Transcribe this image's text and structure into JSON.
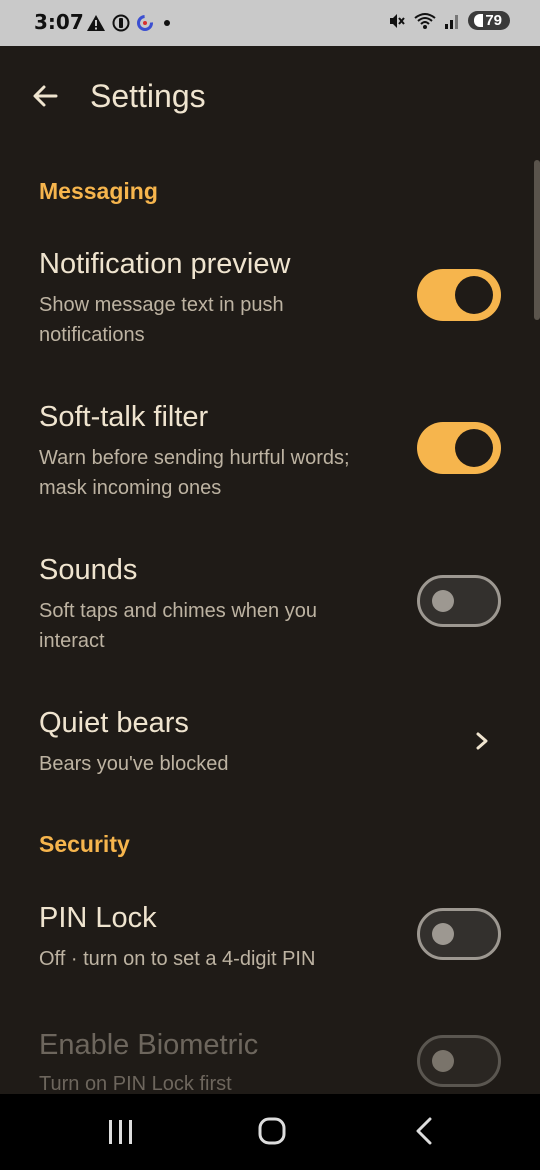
{
  "status_bar": {
    "time": "3:07",
    "battery": "79"
  },
  "header": {
    "title": "Settings"
  },
  "sections": {
    "messaging": {
      "title": "Messaging",
      "notification_preview": {
        "title": "Notification preview",
        "subtitle": "Show message text in push notifications",
        "enabled": true
      },
      "soft_talk_filter": {
        "title": "Soft-talk filter",
        "subtitle": "Warn before sending hurtful words; mask incoming ones",
        "enabled": true
      },
      "sounds": {
        "title": "Sounds",
        "subtitle": "Soft taps and chimes when you interact",
        "enabled": false
      },
      "quiet_bears": {
        "title": "Quiet bears",
        "subtitle": "Bears you've blocked"
      }
    },
    "security": {
      "title": "Security",
      "pin_lock": {
        "title": "PIN Lock",
        "subtitle": "Off · turn on to set a 4-digit PIN",
        "enabled": false
      },
      "biometric": {
        "title": "Enable Biometric",
        "subtitle": "Turn on PIN Lock first",
        "enabled": false,
        "disabled": true
      }
    }
  },
  "colors": {
    "background": "#1f1b17",
    "accent": "#f6b54d",
    "text": "#efe4cf",
    "subtext": "#bdb3a2"
  }
}
